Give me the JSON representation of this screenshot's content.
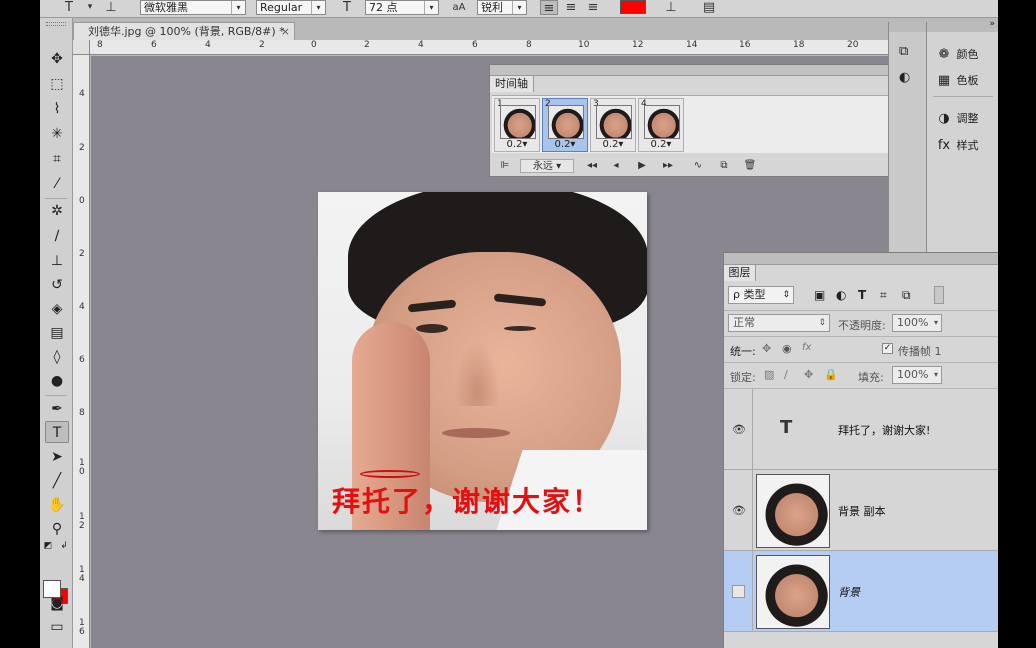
{
  "options_bar": {
    "font_family": "微软雅黑",
    "font_style": "Regular",
    "font_size": "72 点",
    "aa_icon": "aA",
    "antialias": "锐利",
    "color": "#ff0000"
  },
  "document": {
    "tab_title": "刘德华.jpg @ 100% (背景, RGB/8#) *",
    "close": "×",
    "ruler_h": [
      "8",
      "6",
      "4",
      "2",
      "0",
      "2",
      "4",
      "6",
      "8",
      "10",
      "12",
      "14",
      "16",
      "18",
      "20"
    ],
    "ruler_v": [
      "4",
      "2",
      "0",
      "2",
      "4",
      "6",
      "8",
      "1\n0",
      "1\n2",
      "1\n4",
      "1\n6"
    ],
    "photo_caption": "拜托了，谢谢大家！"
  },
  "timeline": {
    "title": "时间轴",
    "frames": [
      {
        "num": "1",
        "delay": "0.2▾"
      },
      {
        "num": "2",
        "delay": "0.2▾"
      },
      {
        "num": "3",
        "delay": "0.2▾"
      },
      {
        "num": "4",
        "delay": "0.2▾"
      }
    ],
    "selected_frame": 2,
    "loop": "永远",
    "loop_arrow": "▾"
  },
  "right_dock": {
    "items": [
      {
        "icon": "palette-icon",
        "label": "颜色"
      },
      {
        "icon": "swatches-icon",
        "label": "色板"
      },
      {
        "icon": "adjustments-icon",
        "label": "调整"
      },
      {
        "icon": "styles-icon",
        "label": "样式"
      }
    ]
  },
  "layers": {
    "title": "图层",
    "filter": "ρ 类型",
    "blend_mode": "正常",
    "opacity_label": "不透明度:",
    "opacity": "100%",
    "unify_label": "统一:",
    "propagate_label": "传播帧 1",
    "lock_label": "锁定:",
    "fill_label": "填充:",
    "fill": "100%",
    "items": [
      {
        "name": "拜托了，谢谢大家!",
        "type": "text",
        "visible": true
      },
      {
        "name": "背景 副本",
        "type": "image",
        "visible": true
      },
      {
        "name": "背景",
        "type": "image",
        "visible": false,
        "selected": true
      }
    ]
  }
}
